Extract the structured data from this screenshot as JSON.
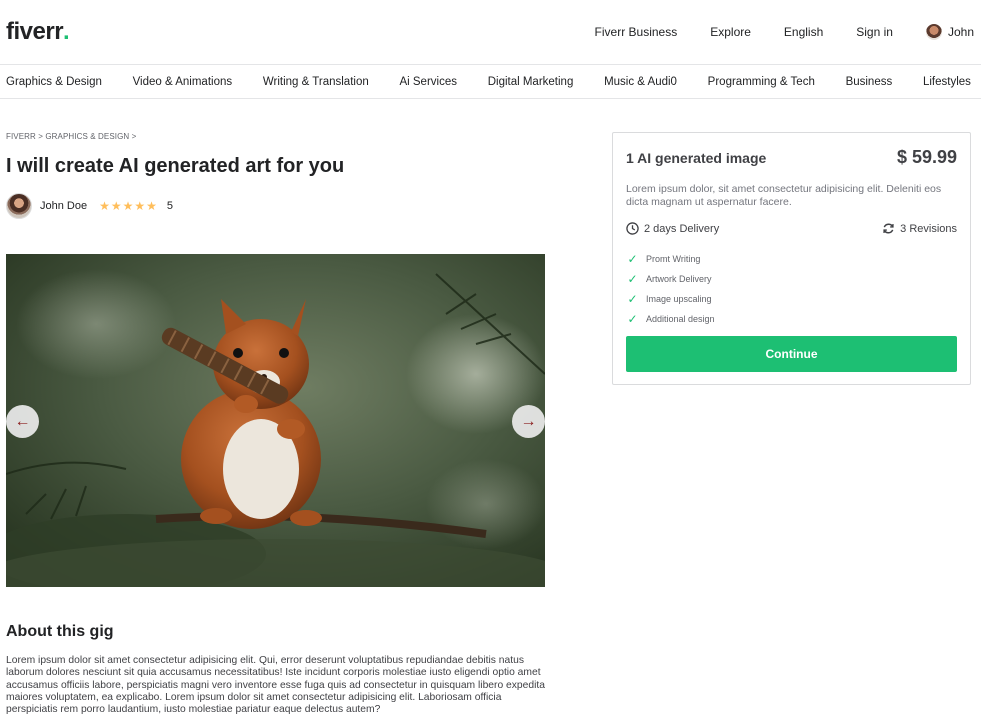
{
  "header": {
    "logo_text": "fiverr",
    "logo_dot": ".",
    "nav": {
      "business": "Fiverr Business",
      "explore": "Explore",
      "language": "English",
      "signin": "Sign in",
      "user": "John"
    }
  },
  "categories": [
    "Graphics & Design",
    "Video & Animations",
    "Writing & Translation",
    "Ai Services",
    "Digital Marketing",
    "Music & Audi0",
    "Programming & Tech",
    "Business",
    "Lifestyles"
  ],
  "breadcrumb": "FIVERR > GRAPHICS & DESIGN >",
  "gig": {
    "title": "I will create AI generated art for you",
    "seller_name": "John Doe",
    "rating": "5",
    "stars": 5
  },
  "gallery": {
    "prev_icon": "arrow-left-icon",
    "next_icon": "arrow-right-icon",
    "image": "squirrel-photo"
  },
  "about": {
    "title": "About this gig",
    "text": "Lorem ipsum dolor sit amet consectetur adipisicing elit. Qui, error deserunt voluptatibus repudiandae debitis natus laborum dolores nesciunt sit quia accusamus necessitatibus! Iste incidunt corporis molestiae iusto eligendi optio amet accusamus officiis labore, perspiciatis magni vero inventore esse fuga quis ad consectetur in quisquam libero expedita maiores voluptatem, ea explicabo. Lorem ipsum dolor sit amet consectetur adipisicing elit. Laboriosam officia perspiciatis rem porro laudantium, iusto molestiae pariatur eaque delectus autem?"
  },
  "package": {
    "name": "1 AI generated image",
    "price": "$ 59.99",
    "description": "Lorem ipsum dolor, sit amet consectetur adipisicing elit. Deleniti eos dicta magnam ut aspernatur facere.",
    "delivery": "2 days Delivery",
    "revisions": "3 Revisions",
    "features": [
      "Promt Writing",
      "Artwork Delivery",
      "Image upscaling",
      "Additional design"
    ],
    "continue_label": "Continue"
  },
  "colors": {
    "accent": "#1dbf73",
    "star": "#ffbe5b",
    "arrow": "#8b1e1e"
  }
}
